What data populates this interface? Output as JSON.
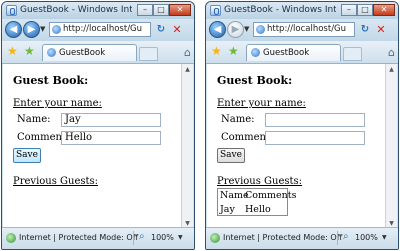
{
  "windows": [
    {
      "title": "GuestBook - Windows Internet ...",
      "address": "http://localhost/Gu",
      "tab": "GuestBook",
      "heading": "Guest Book:",
      "enter_label": "Enter your name:",
      "name_label": "Name:",
      "name_value": "Jay",
      "comments_label": "Comments:",
      "comments_value": "Hello",
      "save": "Save",
      "previous_label": "Previous Guests:",
      "status": "Internet | Protected Mode: Off",
      "zoom": "100%"
    },
    {
      "title": "GuestBook - Windows Internet ...",
      "address": "http://localhost/Gu",
      "tab": "GuestBook",
      "heading": "Guest Book:",
      "enter_label": "Enter your name:",
      "name_label": "Name:",
      "name_value": "",
      "comments_label": "Comments:",
      "comments_value": "",
      "save": "Save",
      "previous_label": "Previous Guests:",
      "guests_table": {
        "headers": [
          "Name",
          "Comments"
        ],
        "rows": [
          [
            "Jay",
            "Hello"
          ]
        ]
      },
      "status": "Internet | Protected Mode: Off",
      "zoom": "100%"
    }
  ],
  "icons": {
    "back": "back-arrow-icon",
    "forward": "forward-arrow-icon",
    "refresh": "refresh-icon",
    "stop": "stop-icon",
    "favorites": "favorites-star-icon",
    "add_favorites": "add-favorites-icon",
    "zoom": "zoom-icon"
  }
}
